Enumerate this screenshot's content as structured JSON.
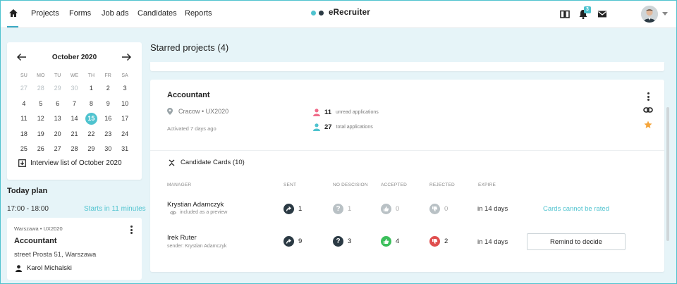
{
  "nav": {
    "links": [
      "Projects",
      "Forms",
      "Job ads",
      "Candidates",
      "Reports"
    ],
    "brand": "eRecruiter",
    "notifications_count": "3",
    "colors": {
      "accent": "#4fc3cf",
      "brand_dot_1": "#4fc3cf",
      "brand_dot_2": "#2b3a44"
    }
  },
  "calendar": {
    "month": "October 2020",
    "weekdays": [
      "SU",
      "MO",
      "TU",
      "WE",
      "TH",
      "FR",
      "SA"
    ],
    "weeks": [
      [
        "27",
        "28",
        "29",
        "30",
        "1",
        "2",
        "3"
      ],
      [
        "4",
        "5",
        "6",
        "7",
        "8",
        "9",
        "10"
      ],
      [
        "11",
        "12",
        "13",
        "14",
        "15",
        "16",
        "17"
      ],
      [
        "18",
        "19",
        "20",
        "21",
        "22",
        "23",
        "24"
      ],
      [
        "25",
        "26",
        "27",
        "28",
        "29",
        "30",
        "31"
      ]
    ],
    "selected_day": "15",
    "interview_link": "Interview list of October 2020"
  },
  "today_plan": {
    "title": "Today plan",
    "time": "17:00 - 18:00",
    "starts": "Starts in 11 minutes",
    "card": {
      "meta": "Warszawa • UX2020",
      "title": "Accountant",
      "address": "street Prosta 51, Warszawa",
      "person": "Karol Michalski"
    }
  },
  "main": {
    "title": "Starred projects (4)",
    "project": {
      "title": "Accountant",
      "location": "Cracow • UX2020",
      "activated": "Activated 7 days ago",
      "unread_count": "11",
      "unread_label": "unread applications",
      "total_count": "27",
      "total_label": "total applications"
    },
    "candidate_cards": {
      "toggle_label": "Candidate Cards (10)",
      "headers": {
        "manager": "MANAGER",
        "sent": "SENT",
        "no_decision": "NO DESCISION",
        "accepted": "ACCEPTED",
        "rejected": "REJECTED",
        "expire": "EXPIRE"
      },
      "rows": [
        {
          "manager": "Krystian Adamczyk",
          "sub": "included as a preview",
          "sent": "1",
          "no_decision": "1",
          "accepted": "0",
          "rejected": "0",
          "expire": "in 14 days",
          "action": "Cards cannot be rated"
        },
        {
          "manager": "Irek Ruter",
          "sub": "sender: Krystian Adamczyk",
          "sent": "9",
          "no_decision": "3",
          "accepted": "4",
          "rejected": "2",
          "expire": "in 14 days",
          "action": "Remind to decide"
        }
      ]
    }
  },
  "status_colors": {
    "accepted": "#3bbf5b",
    "rejected": "#e04e4e",
    "neutral": "#2b3a44",
    "muted": "#b9c1c5",
    "unread_icon": "#f06c8a",
    "total_icon": "#4fc3cf",
    "star": "#f5a53b"
  }
}
